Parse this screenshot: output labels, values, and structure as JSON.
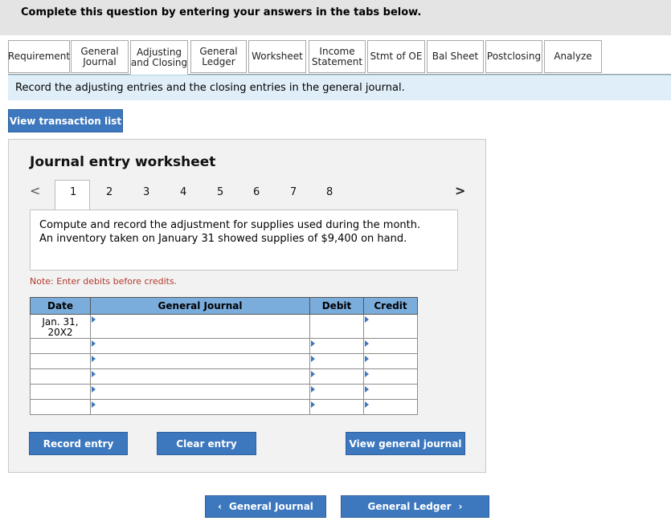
{
  "banner": "Complete this question by entering your answers in the tabs below.",
  "tabs": [
    {
      "label": "Requirement"
    },
    {
      "label": "General\nJournal"
    },
    {
      "label": "Adjusting\nand Closing"
    },
    {
      "label": "General\nLedger"
    },
    {
      "label": "Worksheet"
    },
    {
      "label": "Income\nStatement"
    },
    {
      "label": "Stmt of OE"
    },
    {
      "label": "Bal Sheet"
    },
    {
      "label": "Postclosing"
    },
    {
      "label": "Analyze"
    }
  ],
  "instruction": "Record the adjusting entries and the closing entries in the general journal.",
  "view_transaction_list": "View transaction list",
  "worksheet": {
    "title": "Journal entry worksheet",
    "prev_arrow": "<",
    "next_arrow": ">",
    "numbers": [
      "1",
      "2",
      "3",
      "4",
      "5",
      "6",
      "7",
      "8"
    ],
    "active": "1",
    "question_line1": "Compute and record the adjustment for supplies used during the month.",
    "question_line2": "An inventory taken on January 31 showed supplies of $9,400 on hand.",
    "note": "Note: Enter debits before credits.",
    "headers": {
      "date": "Date",
      "journal": "General Journal",
      "debit": "Debit",
      "credit": "Credit"
    },
    "date_line1": "Jan. 31,",
    "date_line2": "20X2"
  },
  "buttons": {
    "record": "Record entry",
    "clear": "Clear entry",
    "view_journal": "View general journal",
    "prev": "General Journal",
    "next": "General Ledger"
  },
  "colors": {
    "button": "#3d78bf",
    "header": "#7aaddc",
    "banner": "#e4e4e4"
  }
}
